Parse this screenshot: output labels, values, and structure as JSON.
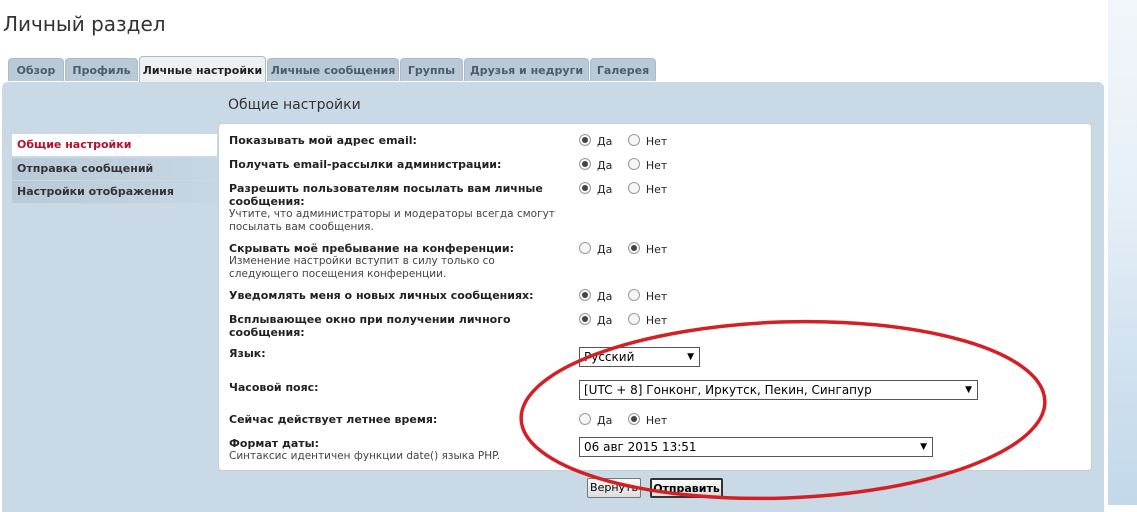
{
  "page": {
    "title": "Личный раздел"
  },
  "tabs": [
    {
      "label": "Обзор"
    },
    {
      "label": "Профиль"
    },
    {
      "label": "Личные настройки",
      "active": true
    },
    {
      "label": "Личные сообщения"
    },
    {
      "label": "Группы"
    },
    {
      "label": "Друзья и недруги"
    },
    {
      "label": "Галерея"
    }
  ],
  "section": {
    "title": "Общие настройки"
  },
  "sidebar": {
    "items": [
      {
        "label": "Общие настройки",
        "active": true
      },
      {
        "label": "Отправка сообщений"
      },
      {
        "label": "Настройки отображения"
      }
    ]
  },
  "settings": {
    "yes_label": "Да",
    "no_label": "Нет",
    "show_email": {
      "label": "Показывать мой адрес email:",
      "value": "Да"
    },
    "admin_mailing": {
      "label": "Получать email-рассылки администрации:",
      "value": "Да"
    },
    "allow_pm": {
      "label_line1": "Разрешить пользователям посылать вам личные",
      "label_line2": "сообщения:",
      "hint_line1": "Учтите, что администраторы и модераторы всегда смогут",
      "hint_line2": "посылать вам сообщения.",
      "value": "Да"
    },
    "hide_online": {
      "label": "Скрывать моё пребывание на конференции:",
      "hint_line1": "Изменение настройки вступит в силу только со",
      "hint_line2": "следующего посещения конференции.",
      "value": "Нет"
    },
    "notify_pm": {
      "label": "Уведомлять меня о новых личных сообщениях:",
      "value": "Да"
    },
    "popup_pm": {
      "label_line1": "Всплывающее окно при получении личного",
      "label_line2": "сообщения:",
      "value": "Да"
    },
    "language": {
      "label": "Язык:",
      "selected": "Русский"
    },
    "timezone": {
      "label": "Часовой пояс:",
      "selected": "[UTC + 8] Гонконг, Иркутск, Пекин, Сингапур"
    },
    "dst": {
      "label": "Сейчас действует летнее время:",
      "value": "Нет"
    },
    "date_format": {
      "label": "Формат даты:",
      "hint": "Синтаксис идентичен функции date() языка PHP.",
      "selected": "06 авг 2015 13:51"
    }
  },
  "buttons": {
    "reset": "Вернуть",
    "submit": "Отправить"
  },
  "colors": {
    "annotation_ellipse": "#d41f24",
    "active_nav_text": "#b5122a",
    "panel_bg": "#cad9e6"
  }
}
